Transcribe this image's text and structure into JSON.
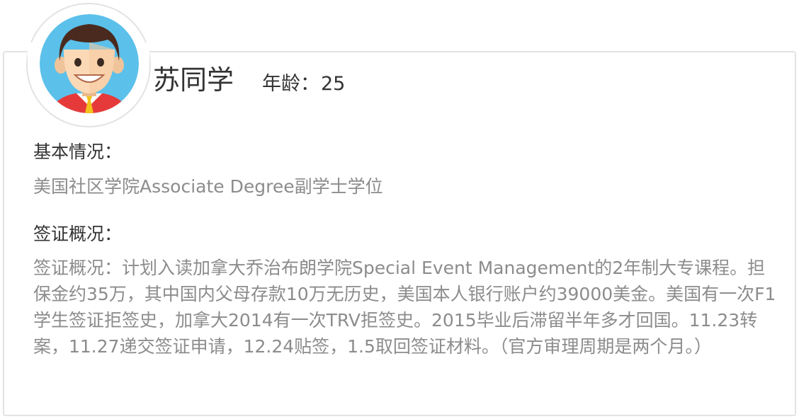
{
  "profile": {
    "name": "苏同学",
    "age_label": "年龄：",
    "age_value": "25"
  },
  "basic": {
    "title": "基本情况：",
    "text": "美国社区学院Associate Degree副学士学位"
  },
  "visa": {
    "title": "签证概况：",
    "text": "签证概况：计划入读加拿大乔治布朗学院Special Event Management的2年制大专课程。担保金约35万，其中国内父母存款10万无历史，美国本人银行账户约39000美金。美国有一次F1学生签证拒签史，加拿大2014有一次TRV拒签史。2015毕业后滞留半年多才回国。11.23转案，11.27递交签证申请，12.24贴签，1.5取回签证材料。（官方审理周期是两个月。）"
  },
  "colors": {
    "title_text": "#333333",
    "body_text": "#8c8c8c",
    "border": "#e3e3e3",
    "avatar_bg": "#5bc0ea",
    "hair": "#4a2a1e",
    "skin": "#fcd9b6",
    "shirt": "#e63a3a"
  }
}
